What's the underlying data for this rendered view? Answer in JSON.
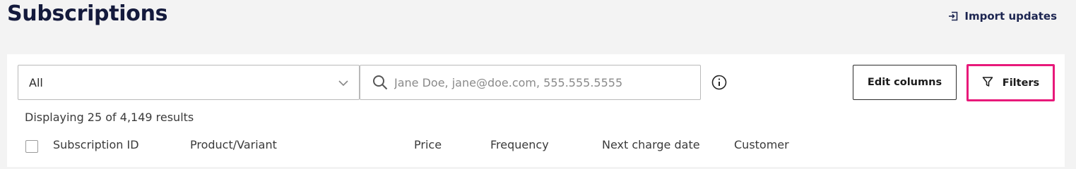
{
  "header": {
    "title": "Subscriptions",
    "import_label": "Import updates"
  },
  "toolbar": {
    "status_select_value": "All",
    "search_placeholder": "Jane Doe, jane@doe.com, 555.555.5555",
    "edit_columns_label": "Edit columns",
    "filters_label": "Filters"
  },
  "results": {
    "text": "Displaying 25 of 4,149 results"
  },
  "table": {
    "columns": [
      "Subscription ID",
      "Product/Variant",
      "Price",
      "Frequency",
      "Next charge date",
      "Customer"
    ]
  },
  "colors": {
    "highlight": "#e8197a",
    "title": "#141a3c",
    "background": "#f3f3f3"
  },
  "icons": [
    "import-icon",
    "chevron-down-icon",
    "search-icon",
    "info-icon",
    "filter-icon"
  ]
}
